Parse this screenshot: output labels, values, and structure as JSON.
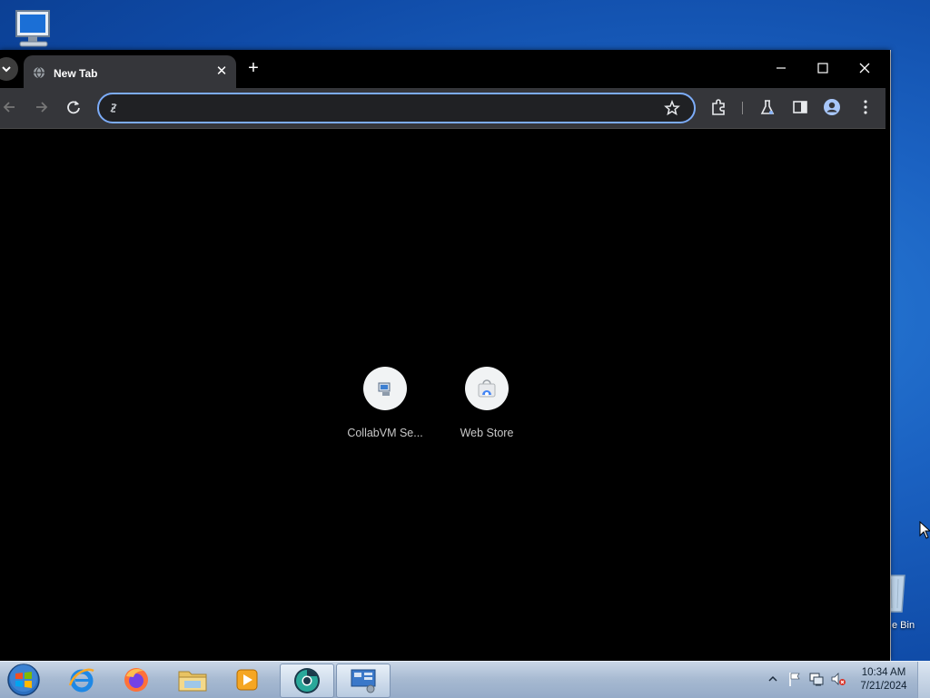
{
  "desktop": {
    "icons": [
      "computer-icon",
      "recycle-bin-icon"
    ],
    "recycle_bin_label": "e Bin"
  },
  "browser": {
    "tab": {
      "title": "New Tab",
      "favicon": "globe-icon"
    },
    "window_controls": [
      "minimize-icon",
      "maximize-icon",
      "close-icon"
    ],
    "omnibox": {
      "value": "",
      "placeholder": ""
    },
    "toolbar_icons": [
      "extensions-icon",
      "labs-icon",
      "side-panel-icon",
      "profile-icon",
      "menu-icon"
    ],
    "shortcuts": [
      {
        "label": "CollabVM Se...",
        "icon": "collabvm-icon"
      },
      {
        "label": "Web Store",
        "icon": "web-store-icon"
      }
    ],
    "colors": {
      "accent": "#7cacf8",
      "toolbar": "#35363a",
      "background": "#000000"
    }
  },
  "taskbar": {
    "apps": [
      "internet-explorer-icon",
      "firefox-icon",
      "file-explorer-icon",
      "media-player-icon",
      "chrome-icon",
      "control-panel-icon"
    ],
    "tray_icons": [
      "show-hidden-icons",
      "action-center-flag-icon",
      "network-icon",
      "volume-muted-icon"
    ],
    "clock": {
      "time": "10:34 AM",
      "date": "7/21/2024"
    }
  }
}
